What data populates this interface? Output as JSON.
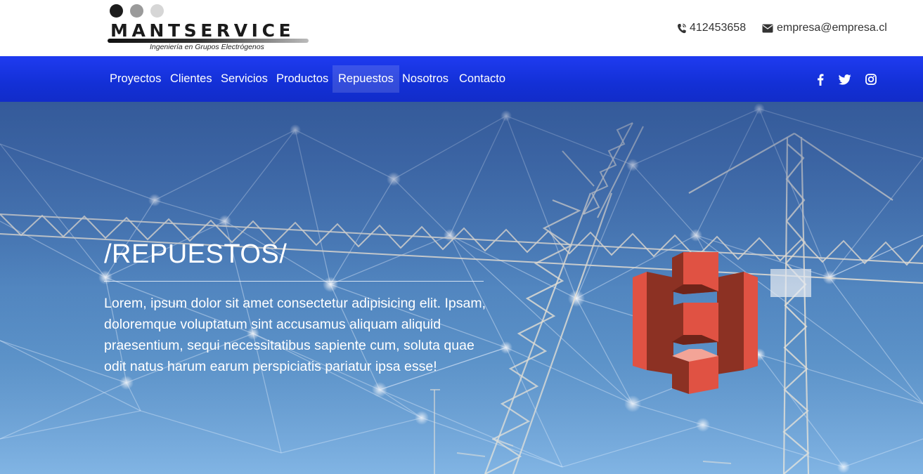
{
  "brand": {
    "name": "MANTSERVICE",
    "tagline": "Ingeniería en Grupos Electrógenos",
    "dot_colors": [
      "#1c1c1c",
      "#9a9a9a",
      "#d6d6d6"
    ]
  },
  "contact": {
    "phone": "412453658",
    "email": "empresa@empresa.cl",
    "phone_icon": "phone-icon",
    "email_icon": "envelope-icon"
  },
  "nav": {
    "items": [
      "Proyectos",
      "Clientes",
      "Servicios",
      "Productos",
      "Repuestos",
      "Nosotros",
      "Contacto"
    ],
    "active": "Repuestos",
    "social": [
      "facebook-icon",
      "twitter-icon",
      "instagram-icon"
    ]
  },
  "hero": {
    "title": "/REPUESTOS/",
    "text": "Lorem, ipsum dolor sit amet consectetur adipisicing elit. Ipsam, doloremque voluptatum sint accusamus aliquam aliquid praesentium, sequi necessitatibus sapiente cum, soluta quae odit natus harum earum perspiciatis pariatur ipsa esse!",
    "icon": "storage-blocks-icon",
    "background": "crane-network-photo"
  },
  "colors": {
    "nav_blue": "#1a33dd",
    "icon_red": "#e05243",
    "icon_dark_red": "#8c3123",
    "text_dark": "#333333"
  }
}
